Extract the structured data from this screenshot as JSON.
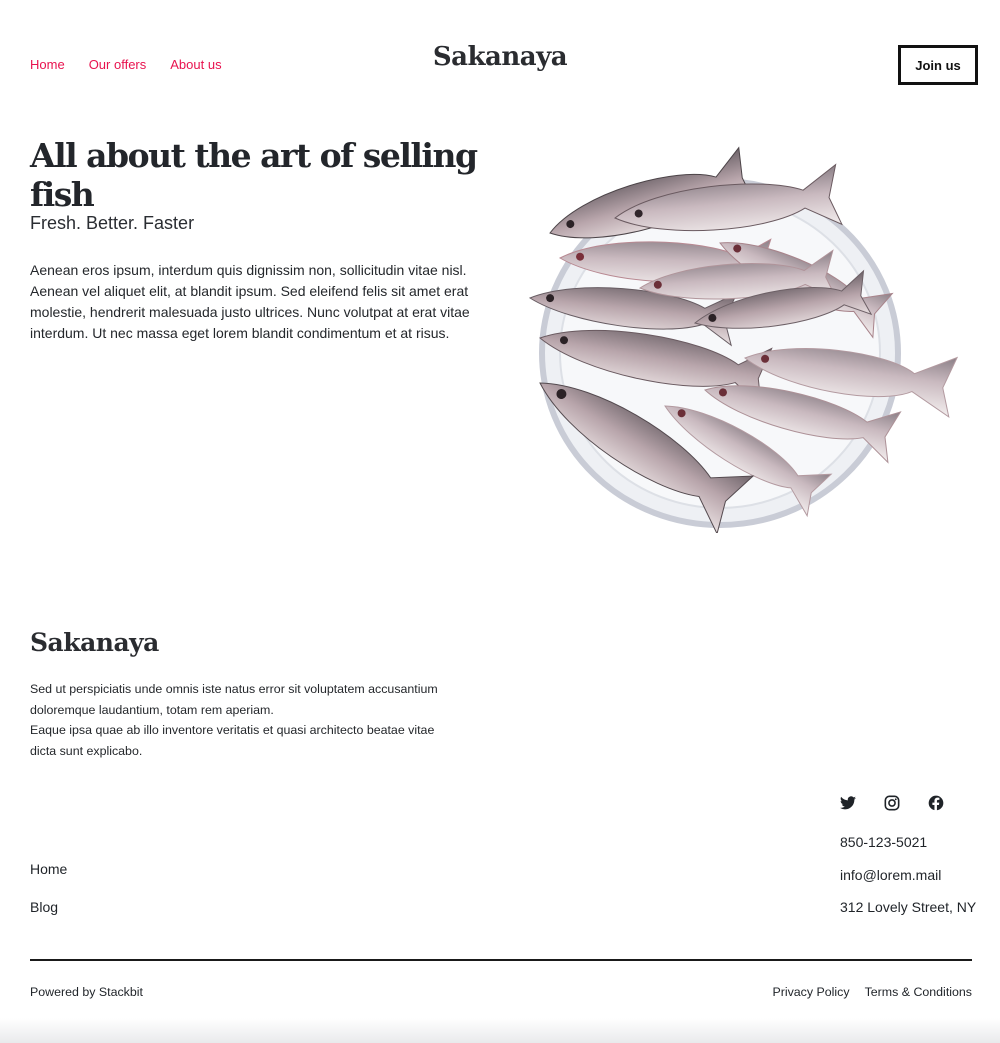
{
  "header": {
    "nav": [
      "Home",
      "Our offers",
      "About us"
    ],
    "brand": "Sakanaya",
    "join_label": "Join us"
  },
  "hero": {
    "title": "All about the art of selling fish",
    "subtitle": "Fresh. Better. Faster",
    "body": "Aenean eros ipsum, interdum quis dignissim non, sollicitudin vitae nisl. Aenean vel aliquet elit, at blandit ipsum. Sed eleifend felis sit amet erat molestie, hendrerit malesuada justo ultrices. Nunc volutpat at erat vitae interdum. Ut nec massa eget lorem blandit condimentum et at risus."
  },
  "footer": {
    "brand": "Sakanaya",
    "text": [
      "Sed ut perspiciatis unde omnis iste natus error sit voluptatem accusantium doloremque laudantium, totam rem aperiam.",
      "Eaque ipsa quae ab illo inventore veritatis et quasi architecto beatae vitae dicta sunt explicabo."
    ],
    "social_icons": [
      "twitter-icon",
      "instagram-icon",
      "facebook-icon"
    ],
    "contact": [
      "850-123-5021",
      "info@lorem.mail",
      "312 Lovely Street, NY"
    ],
    "links": [
      "Home",
      "Blog"
    ],
    "powered": "Powered by Stackbit",
    "legal": [
      "Privacy Policy",
      "Terms & Conditions"
    ]
  },
  "colors": {
    "accent": "#e8134f",
    "text": "#1f2328",
    "border": "#111111"
  }
}
